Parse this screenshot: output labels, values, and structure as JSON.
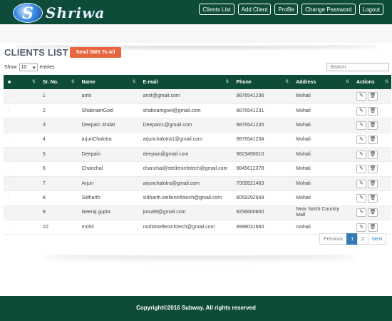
{
  "brand": {
    "name": "Shriwa",
    "logo_letter": "S"
  },
  "nav": [
    "Clients List",
    "Add Client",
    "Profile",
    "Change Password",
    "Logout"
  ],
  "page": {
    "title": "CLIENTS LIST",
    "sms_button": "Send SMS To All"
  },
  "show": {
    "label_before": "Show",
    "value": "10",
    "label_after": "entries"
  },
  "search": {
    "placeholder": "Search"
  },
  "table": {
    "headers": [
      "",
      "Sr. No.",
      "Name",
      "E-mail",
      "Phone",
      "Address",
      "Actions"
    ],
    "rows": [
      {
        "sr": "1",
        "name": "amit",
        "email": "amit@gmail.com",
        "phone": "9876541236",
        "address": "Mohali"
      },
      {
        "sr": "2",
        "name": "ShabnamGoel",
        "email": "shabnamgoel@gmail.com",
        "phone": "9876541231",
        "address": "Mohali"
      },
      {
        "sr": "3",
        "name": "Deepain Jindal",
        "email": "Deepain1@gmail.com",
        "phone": "9876541235",
        "address": "Mohali"
      },
      {
        "sr": "4",
        "name": "arjunChalotra",
        "email": "arjunchalotra1@gmail.com",
        "phone": "9876541234",
        "address": "Mohali"
      },
      {
        "sr": "5",
        "name": "Deepain",
        "email": "deepain@gmail.com",
        "phone": "9823490010",
        "address": "Mohali"
      },
      {
        "sr": "6",
        "name": "Chanchal",
        "email": "chanchal@stelleninfotech@gmail.com",
        "phone": "9845612378",
        "address": "Mohali"
      },
      {
        "sr": "7",
        "name": "Arjun",
        "email": "arjunchalotra@gmail.com",
        "phone": "7009521463",
        "address": "Mohali"
      },
      {
        "sr": "8",
        "name": "Sidharth",
        "email": "sidharth.stelleninfotech@gmail.com",
        "phone": "8059292949",
        "address": "Mohali"
      },
      {
        "sr": "9",
        "name": "Neeraj gupta",
        "email": "jonu89@gmail.com",
        "phone": "9256600600",
        "address": "Near North Country Mall"
      },
      {
        "sr": "10",
        "name": "mohit",
        "email": "mohitstelleninfotech@gmail.com",
        "phone": "9988031660",
        "address": "mohali"
      }
    ]
  },
  "pagination": {
    "prev": "Previous",
    "pages": [
      "1",
      "2"
    ],
    "active": "1",
    "next": "Next"
  },
  "footer": {
    "text": "Copyright©2016 Subway. All rights reserved"
  },
  "colors": {
    "primary": "#0e4c39",
    "accent": "#e8663d",
    "link": "#337ab7"
  }
}
